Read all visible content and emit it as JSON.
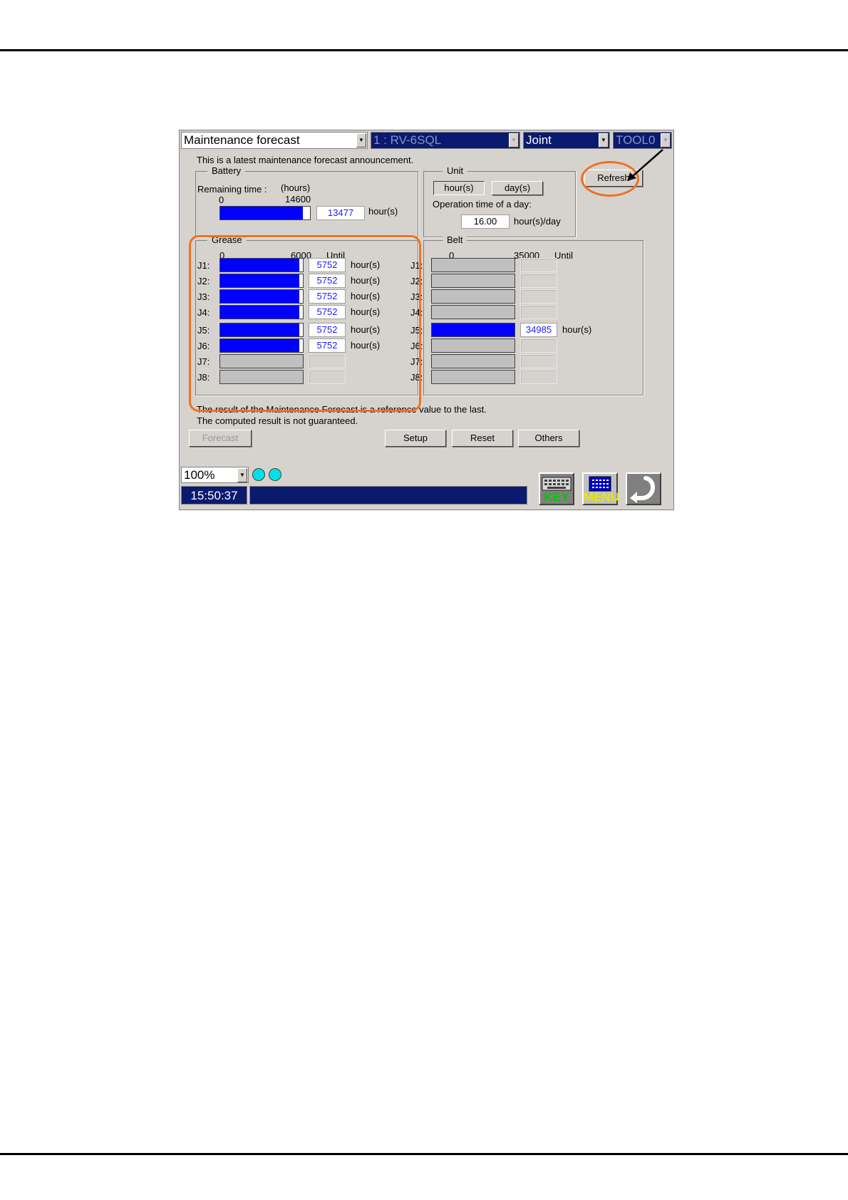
{
  "window": {
    "function_select": "Maintenance forecast",
    "robot_select": "1 : RV-6SQL",
    "coord_select": "Joint",
    "tool_select": "TOOL0",
    "announcement": "This is a latest maintenance forecast announcement."
  },
  "battery": {
    "legend": "Battery",
    "remaining_label": "Remaining time :",
    "unit_paren": "(hours)",
    "scale_min": "0",
    "scale_max": "14600",
    "value": "13477",
    "fraction": 0.923,
    "unit": "hour(s)"
  },
  "unit_group": {
    "legend": "Unit",
    "hours_button": "hour(s)",
    "days_button": "day(s)",
    "operation_label": "Operation time of a day:",
    "operation_value": "16.00",
    "operation_unit": "hour(s)/day"
  },
  "refresh_button": "Refresh",
  "grease": {
    "legend": "Grease",
    "scale_min": "0",
    "scale_max": "6000",
    "until_label": "Until",
    "rows": [
      {
        "label": "J1:",
        "value": "5752",
        "unit": "hour(s)",
        "fraction": 0.959,
        "active": true
      },
      {
        "label": "J2:",
        "value": "5752",
        "unit": "hour(s)",
        "fraction": 0.959,
        "active": true
      },
      {
        "label": "J3:",
        "value": "5752",
        "unit": "hour(s)",
        "fraction": 0.959,
        "active": true
      },
      {
        "label": "J4:",
        "value": "5752",
        "unit": "hour(s)",
        "fraction": 0.959,
        "active": true
      },
      {
        "label": "J5:",
        "value": "5752",
        "unit": "hour(s)",
        "fraction": 0.959,
        "active": true
      },
      {
        "label": "J6:",
        "value": "5752",
        "unit": "hour(s)",
        "fraction": 0.959,
        "active": true
      },
      {
        "label": "J7:",
        "value": "",
        "unit": "",
        "fraction": 0,
        "active": false
      },
      {
        "label": "J8:",
        "value": "",
        "unit": "",
        "fraction": 0,
        "active": false
      }
    ]
  },
  "belt": {
    "legend": "Belt",
    "scale_min": "0",
    "scale_max": "35000",
    "until_label": "Until",
    "rows": [
      {
        "label": "J1:",
        "value": "",
        "unit": "",
        "fraction": 0,
        "active": false
      },
      {
        "label": "J2:",
        "value": "",
        "unit": "",
        "fraction": 0,
        "active": false
      },
      {
        "label": "J3:",
        "value": "",
        "unit": "",
        "fraction": 0,
        "active": false
      },
      {
        "label": "J4:",
        "value": "",
        "unit": "",
        "fraction": 0,
        "active": false
      },
      {
        "label": "J5:",
        "value": "34985",
        "unit": "hour(s)",
        "fraction": 0.9996,
        "active": true
      },
      {
        "label": "J6:",
        "value": "",
        "unit": "",
        "fraction": 0,
        "active": false
      },
      {
        "label": "J7:",
        "value": "",
        "unit": "",
        "fraction": 0,
        "active": false
      },
      {
        "label": "J8:",
        "value": "",
        "unit": "",
        "fraction": 0,
        "active": false
      }
    ]
  },
  "notes": {
    "line1": "The result of the Maintenance Forecast is a reference value to the last.",
    "line2": "The computed result is not guaranteed."
  },
  "buttons": {
    "forecast": "Forecast",
    "setup": "Setup",
    "reset": "Reset",
    "others": "Others"
  },
  "zoom": "100%",
  "status_time": "15:50:37",
  "icons": {
    "key_label": "KEY",
    "menu_label": "MENU",
    "key_icon": "keyboard-icon",
    "menu_icon": "menu-grid-icon",
    "back_icon": "back-arrow-icon"
  },
  "colors": {
    "highlight": "#f07020",
    "bar_fill": "#0000ff",
    "navy": "#0a1a6e",
    "window_bg": "#d6d3ce"
  }
}
